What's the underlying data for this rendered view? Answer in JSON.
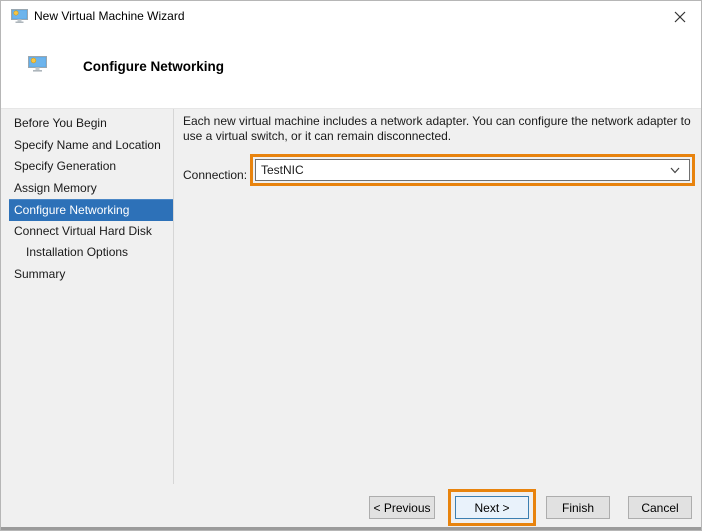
{
  "window": {
    "title": "New Virtual Machine Wizard",
    "close_glyph": "✕"
  },
  "header": {
    "title": "Configure Networking"
  },
  "sidebar": {
    "items": [
      {
        "label": "Before You Begin",
        "selected": false,
        "indent": false
      },
      {
        "label": "Specify Name and Location",
        "selected": false,
        "indent": false
      },
      {
        "label": "Specify Generation",
        "selected": false,
        "indent": false
      },
      {
        "label": "Assign Memory",
        "selected": false,
        "indent": false
      },
      {
        "label": "Configure Networking",
        "selected": true,
        "indent": false
      },
      {
        "label": "Connect Virtual Hard Disk",
        "selected": false,
        "indent": false
      },
      {
        "label": "Installation Options",
        "selected": false,
        "indent": true
      },
      {
        "label": "Summary",
        "selected": false,
        "indent": false
      }
    ]
  },
  "main": {
    "description": "Each new virtual machine includes a network adapter. You can configure the network adapter to use a virtual switch, or it can remain disconnected.",
    "connection_label": "Connection:",
    "connection_value": "TestNIC"
  },
  "footer": {
    "previous_label": "< Previous",
    "next_label": "Next >",
    "finish_label": "Finish",
    "cancel_label": "Cancel"
  },
  "colors": {
    "accent_orange": "#E8830D",
    "selected_blue": "#2D71B8"
  }
}
